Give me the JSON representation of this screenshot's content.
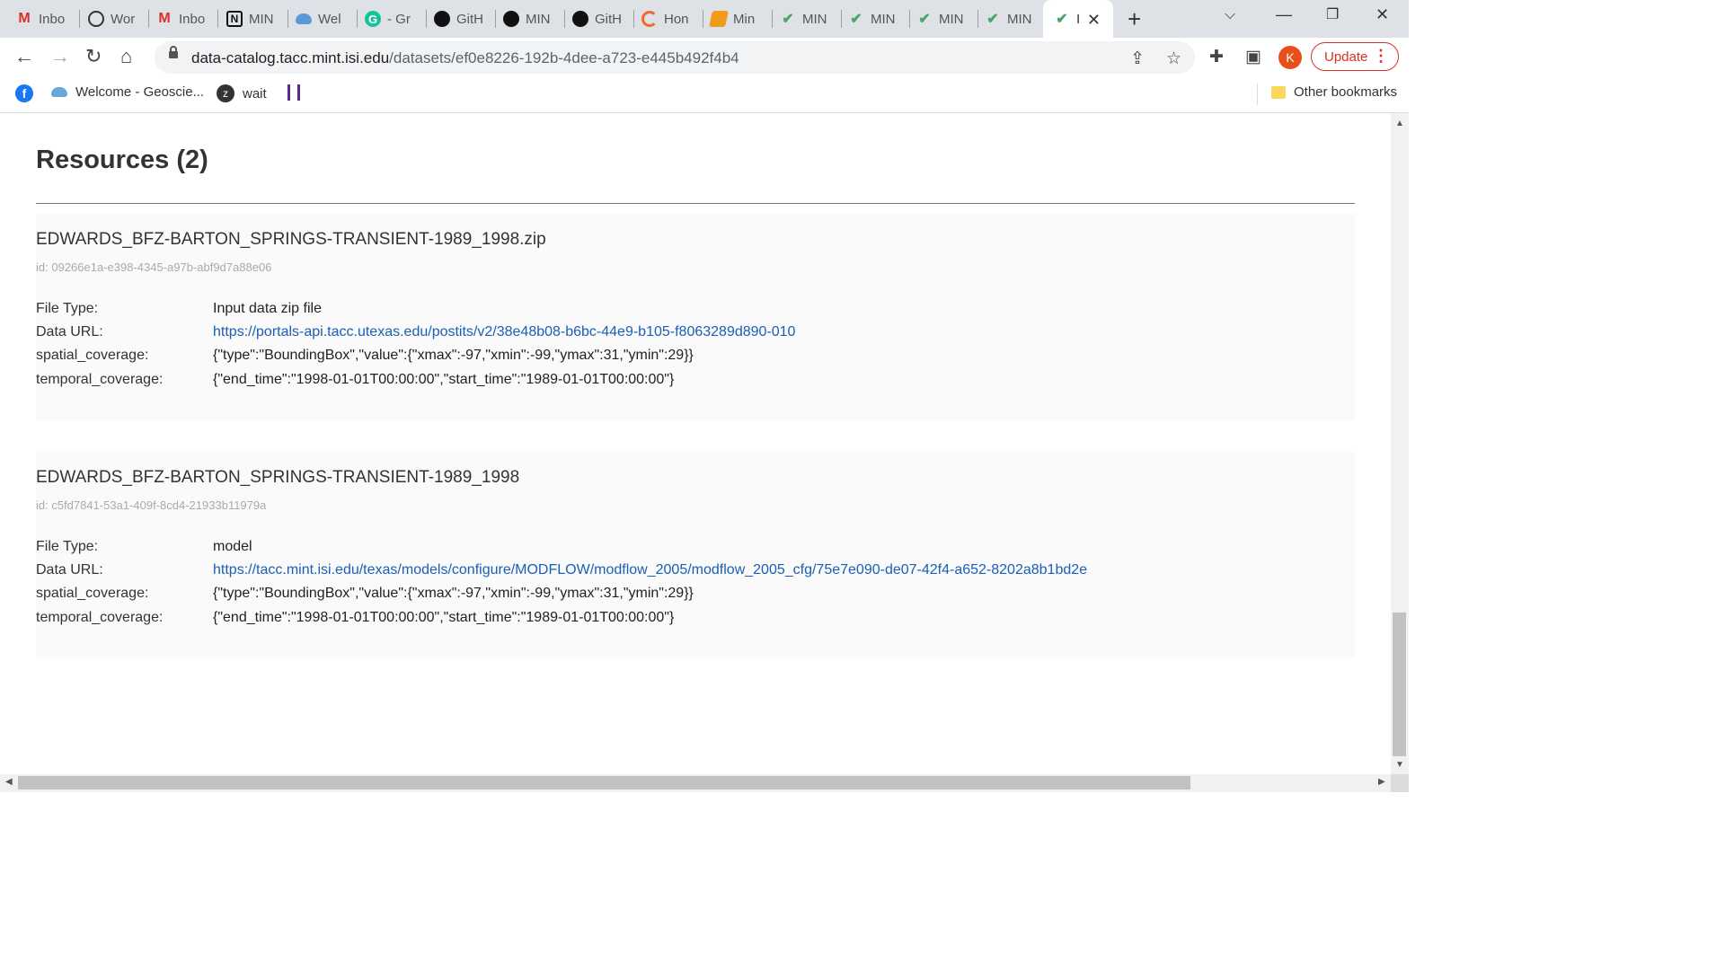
{
  "tabs": [
    {
      "label": "Inbo",
      "icon": "gmail-icon"
    },
    {
      "label": "Wor",
      "icon": "globe-icon"
    },
    {
      "label": "Inbo",
      "icon": "gmail-icon"
    },
    {
      "label": "MIN",
      "icon": "notion-icon"
    },
    {
      "label": "Wel",
      "icon": "cloud-icon"
    },
    {
      "label": "- Gr",
      "icon": "grammarly-icon"
    },
    {
      "label": "GitH",
      "icon": "github-icon"
    },
    {
      "label": "MIN",
      "icon": "github-icon"
    },
    {
      "label": "GitH",
      "icon": "github-icon"
    },
    {
      "label": "Hon",
      "icon": "ring-icon"
    },
    {
      "label": "Min",
      "icon": "book-icon"
    },
    {
      "label": "MIN",
      "icon": "mint-icon"
    },
    {
      "label": "MIN",
      "icon": "mint-icon"
    },
    {
      "label": "MIN",
      "icon": "mint-icon"
    },
    {
      "label": "MIN",
      "icon": "mint-icon"
    }
  ],
  "active_tab": {
    "label": "I",
    "icon": "mint-icon"
  },
  "address_bar": {
    "host": "data-catalog.tacc.mint.isi.edu",
    "path": "/datasets/ef0e8226-192b-4dee-a723-e445b492f4b4"
  },
  "profile_initial": "K",
  "update_label": "Update",
  "bookmarks": [
    {
      "label": "",
      "icon": "facebook-icon"
    },
    {
      "label": "Welcome - Geoscie...",
      "icon": "cloud-icon"
    },
    {
      "label": "wait",
      "icon": "wait-icon"
    },
    {
      "label": "",
      "icon": "bars-icon"
    }
  ],
  "other_bookmarks_label": "Other bookmarks",
  "page": {
    "section_title": "Resources (2)",
    "resources": [
      {
        "title": "EDWARDS_BFZ-BARTON_SPRINGS-TRANSIENT-1989_1998.zip",
        "id": "id: 09266e1a-e398-4345-a97b-abf9d7a88e06",
        "file_type_label": "File Type:",
        "file_type": "Input data zip file",
        "data_url_label": "Data URL:",
        "data_url": "https://portals-api.tacc.utexas.edu/postits/v2/38e48b08-b6bc-44e9-b105-f8063289d890-010",
        "spatial_label": "spatial_coverage:",
        "spatial": "{\"type\":\"BoundingBox\",\"value\":{\"xmax\":-97,\"xmin\":-99,\"ymax\":31,\"ymin\":29}}",
        "temporal_label": "temporal_coverage:",
        "temporal": "{\"end_time\":\"1998-01-01T00:00:00\",\"start_time\":\"1989-01-01T00:00:00\"}"
      },
      {
        "title": "EDWARDS_BFZ-BARTON_SPRINGS-TRANSIENT-1989_1998",
        "id": "id: c5fd7841-53a1-409f-8cd4-21933b11979a",
        "file_type_label": "File Type:",
        "file_type": "model",
        "data_url_label": "Data URL:",
        "data_url": "https://tacc.mint.isi.edu/texas/models/configure/MODFLOW/modflow_2005/modflow_2005_cfg/75e7e090-de07-42f4-a652-8202a8b1bd2e",
        "spatial_label": "spatial_coverage:",
        "spatial": "{\"type\":\"BoundingBox\",\"value\":{\"xmax\":-97,\"xmin\":-99,\"ymax\":31,\"ymin\":29}}",
        "temporal_label": "temporal_coverage:",
        "temporal": "{\"end_time\":\"1998-01-01T00:00:00\",\"start_time\":\"1989-01-01T00:00:00\"}"
      }
    ]
  },
  "colors": {
    "link": "#1a5fb4",
    "update_red": "#d93025",
    "avatar_orange": "#e8501b",
    "card_bg": "#fafafa"
  }
}
